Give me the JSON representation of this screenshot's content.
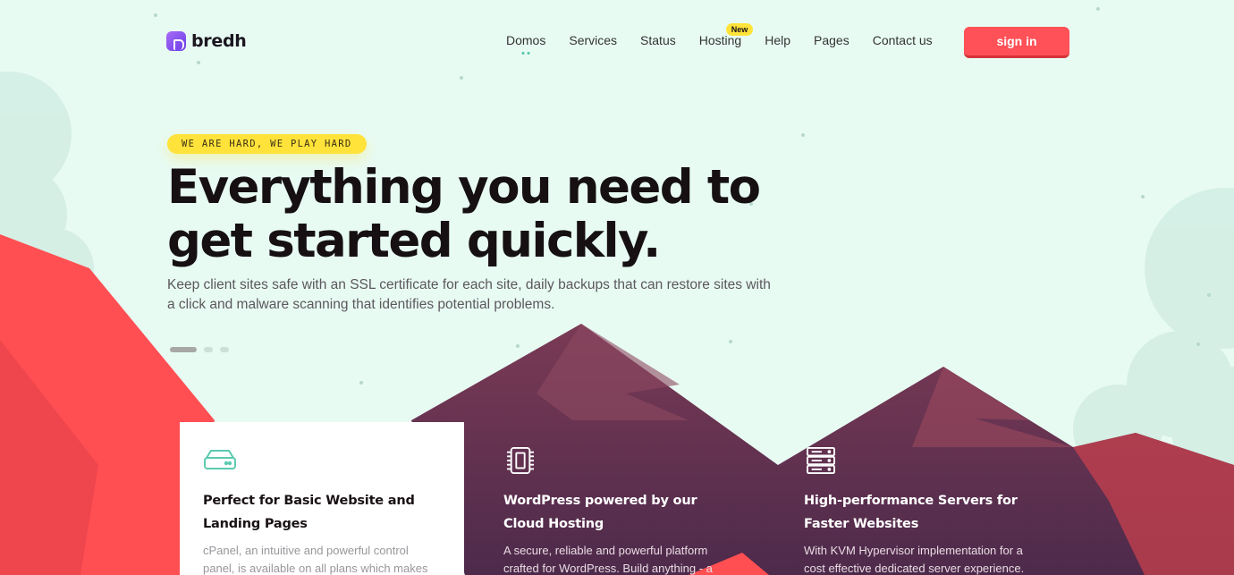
{
  "brand": {
    "name": "bredh"
  },
  "nav": {
    "items": [
      {
        "label": "Domos",
        "active": true
      },
      {
        "label": "Services"
      },
      {
        "label": "Status"
      },
      {
        "label": "Hosting",
        "badge": "New"
      },
      {
        "label": "Help"
      },
      {
        "label": "Pages"
      },
      {
        "label": "Contact us"
      }
    ],
    "signin_label": "sign in"
  },
  "hero": {
    "tagline": "WE ARE HARD, WE PLAY HARD",
    "headline": "Everything you need to get started quickly.",
    "subtext": "Keep client sites safe with an SSL certificate for each site, daily backups that can restore sites with a click and malware scanning that identifies potential problems.",
    "slider": {
      "slides": 3,
      "active_index": 0
    }
  },
  "features": [
    {
      "icon": "hard-drive-icon",
      "title": "Perfect for Basic Website and Landing Pages",
      "desc": "cPanel, an intuitive and powerful control panel, is available on all plans which makes"
    },
    {
      "icon": "chip-icon",
      "title": "WordPress powered by our Cloud Hosting",
      "desc": "A secure, reliable and powerful platform crafted for WordPress. Build anything - a"
    },
    {
      "icon": "server-rack-icon",
      "title": "High-performance Servers for Faster Websites",
      "desc": "With KVM Hypervisor implementation for a cost effective dedicated server experience."
    }
  ],
  "colors": {
    "background": "#e8fbf3",
    "accent": "#ff5157",
    "tag": "#ffe33a",
    "mountain_dark": "#5a3251",
    "mountain_red": "#ff4f52",
    "icon_teal": "#5cc9b0"
  }
}
